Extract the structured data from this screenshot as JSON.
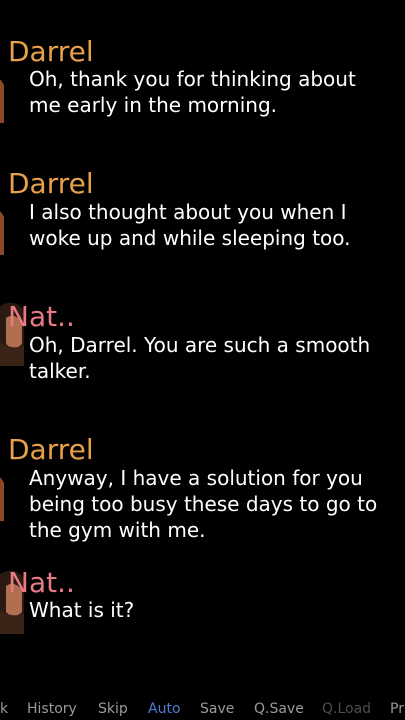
{
  "colors": {
    "background": "#000000",
    "darrel_name": "#e8a04a",
    "nat_name": "#e87a86",
    "dialogue_text": "#ffffff",
    "menu_text": "#9a9a9a",
    "menu_active": "#4a7fd4",
    "menu_disabled": "#4e4e4e"
  },
  "history": [
    {
      "speaker": "Darrel",
      "speaker_key": "darrel",
      "lines": [
        "Oh, thank you for thinking about",
        "me early in the morning."
      ]
    },
    {
      "speaker": "Darrel",
      "speaker_key": "darrel",
      "lines": [
        "I also thought about you when I",
        "woke up and while sleeping too."
      ]
    },
    {
      "speaker": "Nat..",
      "speaker_key": "nat",
      "lines": [
        "Oh, Darrel. You are such a smooth",
        "talker."
      ]
    },
    {
      "speaker": "Darrel",
      "speaker_key": "darrel",
      "lines": [
        "Anyway, I have a solution for you",
        "being too busy these days to go to",
        "the gym with me."
      ]
    },
    {
      "speaker": "Nat..",
      "speaker_key": "nat",
      "lines": [
        "What is it?"
      ]
    }
  ],
  "quick_menu": {
    "back": "k",
    "history": "History",
    "skip": "Skip",
    "auto": "Auto",
    "save": "Save",
    "q_save": "Q.Save",
    "q_load": "Q.Load",
    "prefs": "Pr"
  }
}
